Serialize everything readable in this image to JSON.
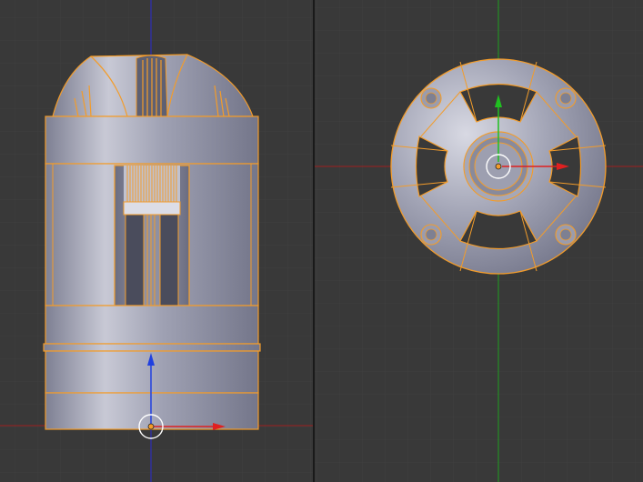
{
  "app": {
    "name": ""
  },
  "colors": {
    "background": "#393939",
    "grid_minor": "#3f3f3f",
    "grid_major": "#444444",
    "separator": "#1a1a1a",
    "axis_x": "#b32020",
    "axis_y": "#1f9e1f",
    "axis_z": "#2a2ad0",
    "selection_outline": "#f39c2a",
    "mesh_dark": "#7d7f92",
    "mesh_mid": "#a3a5b5",
    "mesh_light": "#c9cad6",
    "manip_x": "#e02020",
    "manip_y": "#20c020",
    "manip_z": "#2040e0"
  },
  "viewports": [
    {
      "id": "front",
      "view": "front-orthographic",
      "object": "selected-cylinder-mesh",
      "manipulator": "translate"
    },
    {
      "id": "top",
      "view": "top-orthographic",
      "object": "selected-cylinder-mesh",
      "manipulator": "translate"
    }
  ],
  "icons": [
    "3d-cursor-icon",
    "transform-manipulator-icon",
    "object-origin-icon"
  ]
}
